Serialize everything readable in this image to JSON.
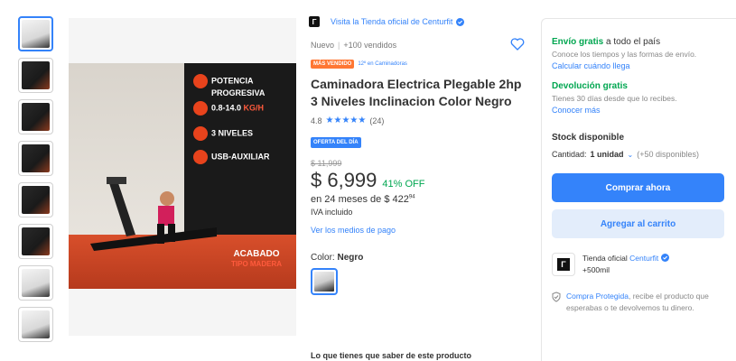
{
  "colors": {
    "accent": "#3483fa",
    "green": "#00a650",
    "orange_badge": "#ff7733",
    "cart_bg": "#e3edfb"
  },
  "gallery": {
    "thumbnails": [
      {
        "name": "thumb-1",
        "style": "light",
        "active": true
      },
      {
        "name": "thumb-2",
        "style": "dark"
      },
      {
        "name": "thumb-3",
        "style": "dark"
      },
      {
        "name": "thumb-4",
        "style": "dark"
      },
      {
        "name": "thumb-5",
        "style": "dark"
      },
      {
        "name": "thumb-6",
        "style": "dark"
      },
      {
        "name": "thumb-7",
        "style": "light"
      },
      {
        "name": "thumb-8",
        "style": "light"
      }
    ],
    "hero": {
      "features": [
        "POTENCIA",
        "PROGRESIVA",
        "0.8-14.0",
        "KG/H",
        "3 NIVELES",
        "USB-AUXILIAR"
      ],
      "finish_title": "ACABADO",
      "finish_sub": "TIPO MADERA"
    }
  },
  "product": {
    "store_link": "Visita la Tienda oficial de Centurfit",
    "condition": "Nuevo",
    "sold": "+100 vendidos",
    "badge_best_seller": "MÁS VENDIDO",
    "rank": "12º en Caminadoras",
    "title": "Caminadora Electrica Plegable 2hp 3 Niveles Inclinacion Color Negro",
    "rating_value": "4.8",
    "rating_count": "(24)",
    "stars": 5,
    "offer_badge": "OFERTA DEL DÍA",
    "old_price": "$ 11,999",
    "price": "$ 6,999",
    "discount": "41% OFF",
    "installments_prefix": "en 24 meses de $ 422",
    "installments_cents": "94",
    "tax_note": "IVA incluido",
    "payments_link": "Ver los medios de pago",
    "color_label": "Color:",
    "color_value": "Negro",
    "know_title": "Lo que tienes que saber de este producto"
  },
  "buy_box": {
    "shipping_strong": "Envío gratis",
    "shipping_rest": " a todo el país",
    "shipping_sub": "Conoce los tiempos y las formas de envío.",
    "shipping_link": "Calcular cuándo llega",
    "return_strong": "Devolución gratis",
    "return_sub": "Tienes 30 días desde que lo recibes.",
    "return_link": "Conocer más",
    "stock_label": "Stock disponible",
    "qty_label": "Cantidad:",
    "qty_value": "1 unidad",
    "qty_available": "(+50 disponibles)",
    "buy_button": "Comprar ahora",
    "cart_button": "Agregar al carrito",
    "seller_prefix": "Tienda oficial ",
    "seller_name": "Centurfit",
    "seller_sales": "+500mil",
    "protect_link": "Compra Protegida",
    "protect_text": ", recibe el producto que esperabas o te devolvemos tu dinero."
  }
}
